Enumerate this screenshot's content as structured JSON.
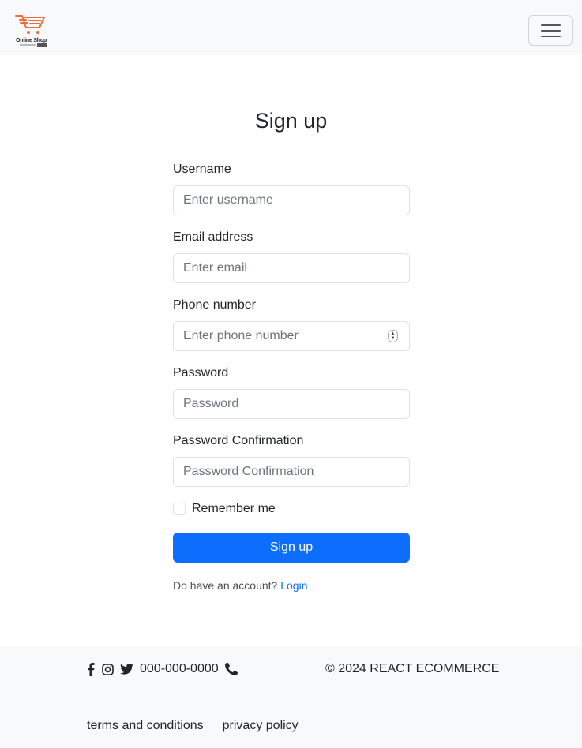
{
  "navbar": {
    "brand": {
      "name": "Online Shop",
      "logo_icon": "shopping-cart-icon",
      "accent_color": "#f26b3a"
    },
    "toggler_icon": "hamburger-menu-icon"
  },
  "page": {
    "title": "Sign up"
  },
  "form": {
    "fields": [
      {
        "label": "Username",
        "placeholder": "Enter username",
        "value": "",
        "type": "text"
      },
      {
        "label": "Email address",
        "placeholder": "Enter email",
        "value": "",
        "type": "email"
      },
      {
        "label": "Phone number",
        "placeholder": "Enter phone number",
        "value": "",
        "type": "number"
      },
      {
        "label": "Password",
        "placeholder": "Password",
        "value": "",
        "type": "password"
      },
      {
        "label": "Password Confirmation",
        "placeholder": "Password Confirmation",
        "value": "",
        "type": "password"
      }
    ],
    "remember_me": {
      "label": "Remember me",
      "checked": false
    },
    "submit_label": "Sign up",
    "submit_color": "#0d6efd",
    "account_prompt": "Do have an account?",
    "login_link": "Login"
  },
  "footer": {
    "social_icons": [
      "facebook-icon",
      "instagram-icon",
      "twitter-icon"
    ],
    "phone": "000-000-0000",
    "phone_icon": "phone-icon",
    "copyright": "© 2024 REACT ECOMMERCE",
    "links": [
      {
        "label": "terms and conditions"
      },
      {
        "label": "privacy policy"
      }
    ]
  }
}
